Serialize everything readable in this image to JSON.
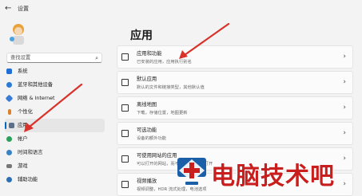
{
  "window": {
    "title": "设置"
  },
  "search": {
    "placeholder": "查找设置"
  },
  "sidebar": {
    "items": [
      {
        "label": "系统",
        "color": "#1f6fd6",
        "active": false
      },
      {
        "label": "蓝牙和其他设备",
        "color": "#2b79d8",
        "active": false
      },
      {
        "label": "网络 & Internet",
        "color": "#3a7bd5",
        "active": false
      },
      {
        "label": "个性化",
        "color": "#d9822b",
        "active": false
      },
      {
        "label": "应用",
        "color": "#5a6f8a",
        "active": true
      },
      {
        "label": "帐户",
        "color": "#2aa05b",
        "active": false
      },
      {
        "label": "时间和语言",
        "color": "#3b82c4",
        "active": false
      },
      {
        "label": "游戏",
        "color": "#777777",
        "active": false
      },
      {
        "label": "辅助功能",
        "color": "#2d6fb3",
        "active": false
      }
    ]
  },
  "main": {
    "title": "应用",
    "cards": [
      {
        "title": "应用和功能",
        "subtitle": "已安装的应用，应用执行别名"
      },
      {
        "title": "默认应用",
        "subtitle": "默认的文件和链接类型，其他默认值"
      },
      {
        "title": "离线地图",
        "subtitle": "下载，存储位置，地图更新"
      },
      {
        "title": "可选功能",
        "subtitle": "设备的额外功能"
      },
      {
        "title": "可使用网站的应用",
        "subtitle": "可以打开的网站，而不是在浏览器中打开"
      },
      {
        "title": "视频播放",
        "subtitle": "视频调整，HDR 流式处理，电池选项"
      }
    ]
  },
  "watermark": {
    "text": "电脑技术吧"
  },
  "colors": {
    "accent": "#0067c0",
    "arrow": "#d8322a",
    "watermark": "#c81e1e"
  }
}
